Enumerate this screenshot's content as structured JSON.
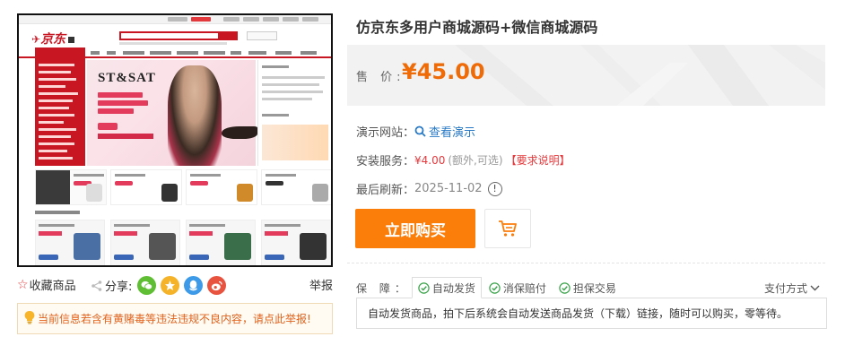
{
  "product": {
    "title": "仿京东多用户商城源码+微信商城源码",
    "price_label": "售  价",
    "price": "¥45.00"
  },
  "thumbnail": {
    "logo_text": "京东",
    "banner_brand": "ST&SAT"
  },
  "actions": {
    "favorite_label": "收藏商品",
    "share_label": "分享:",
    "report_label": "举报",
    "social_icons": [
      "wechat-icon",
      "qzone-icon",
      "qq-icon",
      "weibo-icon"
    ]
  },
  "notice": {
    "text": "当前信息若含有黄赌毒等违法违规不良内容，请点此举报!"
  },
  "info": {
    "demo_label": "演示网站：",
    "demo_link": "查看演示",
    "install_label": "安装服务：",
    "install_price": "¥4.00",
    "install_note": "(额外,可选)",
    "install_link": "【要求说明】",
    "refresh_label": "最后刷新：",
    "refresh_date": "2025-11-02"
  },
  "buttons": {
    "buy_label": "立即购买"
  },
  "guarantee": {
    "label": "保  障：",
    "tags": [
      "自动发货",
      "消保赔付",
      "担保交易"
    ],
    "payment_label": "支付方式",
    "description": "自动发货商品，拍下后系统会自动发送商品发货（下载）链接，随时可以购买，零等待。"
  },
  "colors": {
    "accent_orange": "#fb7d0a",
    "price_orange": "#ee6b08",
    "red": "#e4393c",
    "link_blue": "#2a7ac5",
    "check_green": "#3aa34a"
  }
}
